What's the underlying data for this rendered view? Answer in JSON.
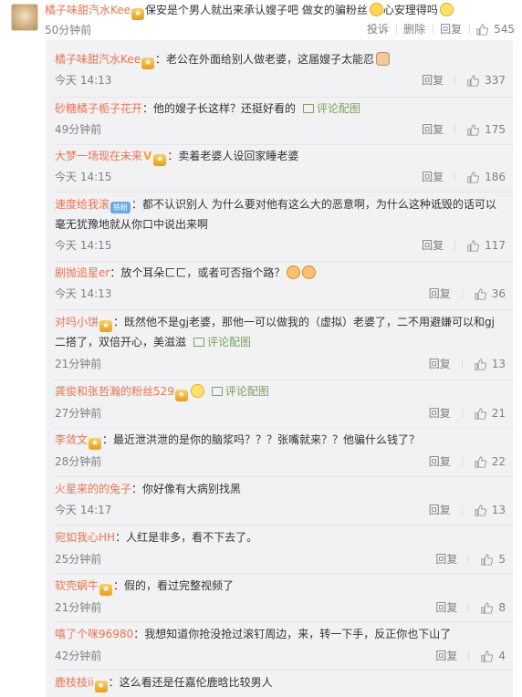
{
  "main": {
    "name": "橘子味甜汽水Kee",
    "text": "保安是个男人就出来承认嫂子吧 做女的骗粉丝",
    "text2": "心安理得吗",
    "time": "50分钟前",
    "report": "投诉",
    "delete": "删除",
    "reply": "回复",
    "likes": "545"
  },
  "replies": [
    {
      "name": "橘子味甜汽水Kee",
      "text": "：老公在外面给别人做老婆，这届嫂子太能忍",
      "time": "今天 14:13",
      "reply": "回复",
      "likes": "337"
    },
    {
      "name": "砂糖橘子栀子花开",
      "text": "：他的嫂子长这样？还挺好看的",
      "pic": "评论配图",
      "time": "49分钟前",
      "reply": "回复",
      "likes": "175"
    },
    {
      "name": "大梦一场现在未来",
      "text": "：卖着老婆人设回家睡老婆",
      "time": "今天 14:15",
      "reply": "回复",
      "likes": "186"
    },
    {
      "name": "速度给我滚",
      "badge": "铁粉",
      "text": "：都不认识别人 为什么要对他有这么大的恶意啊，为什么这种诋毁的话可以毫无犹豫地就从你口中说出来啊",
      "time": "今天 14:15",
      "reply": "回复",
      "likes": "117"
    },
    {
      "name": "剧抛追星er",
      "text": "：放个耳朵ㄈㄈ，或者可否指个路？",
      "time": "今天 14:13",
      "reply": "回复",
      "likes": "36"
    },
    {
      "name": "对吗小饼",
      "text": "：既然他不是gj老婆，那他一可以做我的（虚拟）老婆了，二不用避嫌可以和gj二搭了，双倍开心，美滋滋",
      "pic": "评论配图",
      "time": "21分钟前",
      "reply": "回复",
      "likes": "13"
    },
    {
      "name": "龚俊和张哲瀚的粉丝529",
      "text": "",
      "pic": "评论配图",
      "time": "27分钟前",
      "reply": "回复",
      "likes": "21"
    },
    {
      "name": "李敛文",
      "text": "：最近泄洪泄的是你的脑浆吗？？？张嘴就来？？他骗什么钱了？",
      "time": "28分钟前",
      "reply": "回复",
      "likes": "22"
    },
    {
      "name": "火星来的的兔子",
      "text": "：你好像有大病别找黑",
      "time": "今天 14:17",
      "reply": "回复",
      "likes": "13"
    },
    {
      "name": "宛如我心HH",
      "text": "：人红是非多，看不下去了。",
      "time": "25分钟前",
      "reply": "回复",
      "likes": "5"
    },
    {
      "name": "软壳蜗牛",
      "text": "：假的，看过完整视频了",
      "time": "21分钟前",
      "reply": "回复",
      "likes": "8"
    },
    {
      "name": "嘻了个咪96980",
      "text": "：我想知道你抢没抢过滚钉周边，来，转一下手，反正你也下山了",
      "time": "42分钟前",
      "reply": "回复",
      "likes": "4"
    },
    {
      "name": "鹿枝枝ii",
      "text": "：这么看还是任嘉伦鹿晗比较男人"
    }
  ],
  "colors": {
    "name": "#eb7350",
    "muted": "#808080",
    "reply_bg": "#f2f2f5",
    "pic_link": "#7ba05a"
  }
}
